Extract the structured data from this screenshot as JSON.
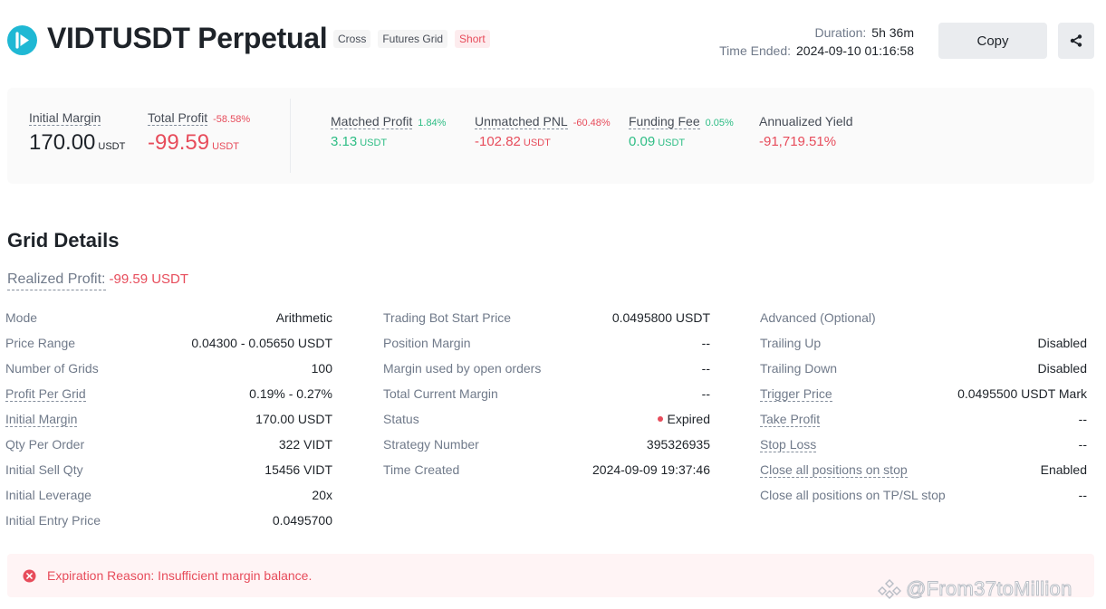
{
  "header": {
    "title": "VIDTUSDT Perpetual",
    "tags": [
      "Cross",
      "Futures Grid",
      "Short"
    ],
    "duration_label": "Duration:",
    "duration_value": "5h 36m",
    "time_ended_label": "Time Ended:",
    "time_ended_value": "2024-09-10 01:16:58",
    "copy_label": "Copy"
  },
  "summary": {
    "initial_margin": {
      "label": "Initial Margin",
      "value": "170.00",
      "unit": "USDT"
    },
    "total_profit": {
      "label": "Total Profit",
      "pct": "-58.58%",
      "value": "-99.59",
      "unit": "USDT"
    },
    "matched_profit": {
      "label": "Matched Profit",
      "pct": "1.84%",
      "value": "3.13",
      "unit": "USDT"
    },
    "unmatched_pnl": {
      "label": "Unmatched PNL",
      "pct": "-60.48%",
      "value": "-102.82",
      "unit": "USDT"
    },
    "funding_fee": {
      "label": "Funding Fee",
      "pct": "0.05%",
      "value": "0.09",
      "unit": "USDT"
    },
    "annualized_yield": {
      "label": "Annualized Yield",
      "value": "-91,719.51%"
    }
  },
  "grid_details": {
    "title": "Grid Details",
    "realized_label": "Realized Profit:",
    "realized_value": "-99.59 USDT",
    "col1": [
      {
        "label": "Mode",
        "value": "Arithmetic"
      },
      {
        "label": "Price Range",
        "value": "0.04300 - 0.05650 USDT"
      },
      {
        "label": "Number of Grids",
        "value": "100"
      },
      {
        "label": "Profit Per Grid",
        "value": "0.19% - 0.27%"
      },
      {
        "label": "Initial Margin",
        "value": "170.00 USDT"
      },
      {
        "label": "Qty Per Order",
        "value": "322 VIDT"
      },
      {
        "label": "Initial Sell Qty",
        "value": "15456 VIDT"
      },
      {
        "label": "Initial Leverage",
        "value": "20x"
      },
      {
        "label": "Initial Entry Price",
        "value": "0.0495700"
      }
    ],
    "col2": [
      {
        "label": "Trading Bot Start Price",
        "value": "0.0495800 USDT"
      },
      {
        "label": "Position Margin",
        "value": "--"
      },
      {
        "label": "Margin used by open orders",
        "value": "--"
      },
      {
        "label": "Total Current Margin",
        "value": "--"
      },
      {
        "label": "Status",
        "value": "Expired"
      },
      {
        "label": "Strategy Number",
        "value": "395326935"
      },
      {
        "label": "Time Created",
        "value": "2024-09-09 19:37:46"
      }
    ],
    "col3": [
      {
        "label": "Advanced (Optional)",
        "value": ""
      },
      {
        "label": "Trailing Up",
        "value": "Disabled"
      },
      {
        "label": "Trailing Down",
        "value": "Disabled"
      },
      {
        "label": "Trigger Price",
        "value": "0.0495500 USDT Mark"
      },
      {
        "label": "Take Profit",
        "value": "--"
      },
      {
        "label": "Stop Loss",
        "value": "--"
      },
      {
        "label": "Close all positions on stop",
        "value": "Enabled"
      },
      {
        "label": "Close all positions on TP/SL stop",
        "value": "--"
      }
    ]
  },
  "alert": {
    "text": "Expiration Reason: Insufficient margin balance."
  },
  "watermark": "@From37toMillion",
  "colors": {
    "red": "#e74c5b",
    "green": "#2ebd85",
    "brand": "#1fb8d4"
  }
}
